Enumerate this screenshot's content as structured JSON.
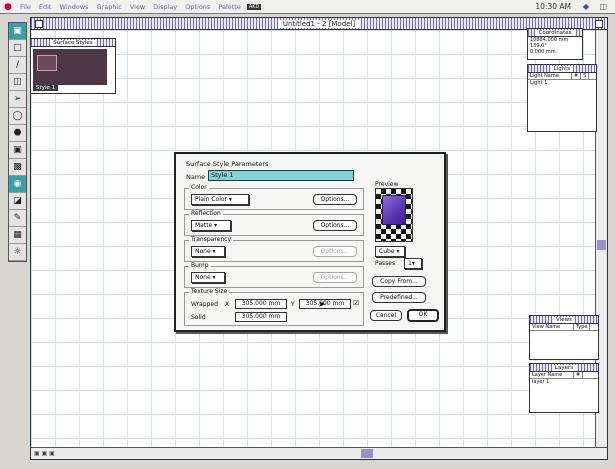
{
  "menubar": {
    "items": [
      "File",
      "Edit",
      "Windows",
      "Graphic",
      "View",
      "Display",
      "Options",
      "Palette"
    ],
    "badge": "AKD",
    "clock": "10:30 AM"
  },
  "window": {
    "title": "Untitled1 - 2 [Model]"
  },
  "surface_styles": {
    "title": "Surface Styles",
    "selected": "Style 1"
  },
  "coordinates": {
    "title": "Coordinates",
    "rows": [
      "10884.000 mm",
      "139.0°",
      "0.000 mm"
    ]
  },
  "lights": {
    "title": "Lights",
    "columns": [
      "Light Name",
      "#",
      "S"
    ],
    "rows": [
      "Light 1"
    ]
  },
  "views": {
    "title": "Views",
    "columns": [
      "View Name",
      "Type"
    ]
  },
  "layers": {
    "title": "Layers",
    "columns": [
      "Layer Name",
      "#"
    ],
    "rows": [
      "layer 1"
    ]
  },
  "dialog": {
    "title": "Surface Style Parameters",
    "name_label": "Name",
    "name_value": "Style 1",
    "color": {
      "label": "Color",
      "value": "Plain Color ▾",
      "button": "Options..."
    },
    "reflection": {
      "label": "Reflection",
      "value": "Matte ▾",
      "button": "Options..."
    },
    "transparency": {
      "label": "Transparency",
      "value": "None ▾",
      "button": "Options..."
    },
    "bump": {
      "label": "Bump",
      "value": "None ▾",
      "button": "Options..."
    },
    "texture": {
      "label": "Texture Size",
      "wrapped_label": "Wrapped",
      "x_label": "X",
      "x_value": "305.000 mm",
      "y_label": "Y",
      "y_value": "305.000 mm",
      "solid_label": "Solid",
      "solid_value": "305.000 mm"
    },
    "preview": {
      "label": "Preview",
      "shape": "Cube ▾",
      "passes_label": "Passes",
      "passes_value": "1▾"
    },
    "copy_from": "Copy From...",
    "predefined": "Predefined...",
    "cancel": "Cancel",
    "ok": "OK"
  }
}
